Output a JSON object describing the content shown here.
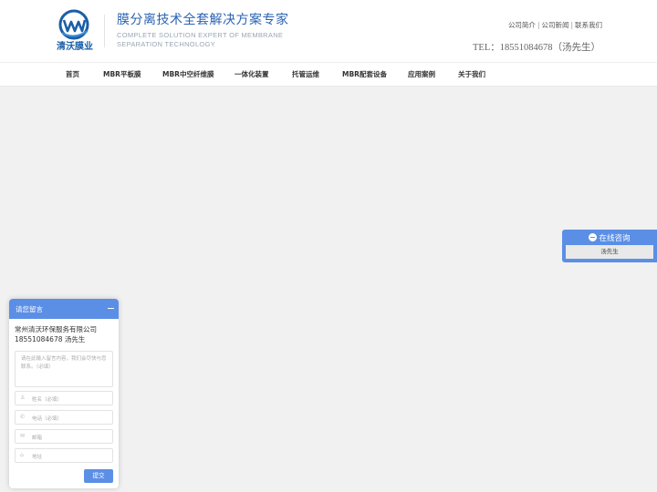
{
  "header": {
    "logo_text": "清沃膜业",
    "slogan_cn": "膜分离技术全套解决方案专家",
    "slogan_en": "COMPLETE SOLUTION EXPERT OF MEMBRANE SEPARATION TECHNOLOGY",
    "top_links": [
      "公司简介",
      "公司新闻",
      "联系我们"
    ],
    "tel": "TEL：18551084678（汤先生）"
  },
  "nav": {
    "items": [
      "首页",
      "MBR平板膜",
      "MBR中空纤维膜",
      "一体化装置",
      "托管运维",
      "MBR配套设备",
      "应用案例",
      "关于我们"
    ]
  },
  "consult": {
    "title": "在线咨询",
    "contact": "汤先生"
  },
  "message": {
    "title": "请您留言",
    "company": "常州清沃环保服务有限公司",
    "phone": "18551084678 汤先生",
    "textarea_placeholder": "请在此输入留言内容，我们会尽快与您联系。（必填）",
    "name_placeholder": "姓名（必填）",
    "tel_placeholder": "电话（必填）",
    "email_placeholder": "邮箱",
    "address_placeholder": "地址",
    "submit_label": "提交"
  },
  "colors": {
    "brand_blue": "#2a63b3",
    "accent": "#5b8fe6",
    "background": "#f1f1f1"
  }
}
